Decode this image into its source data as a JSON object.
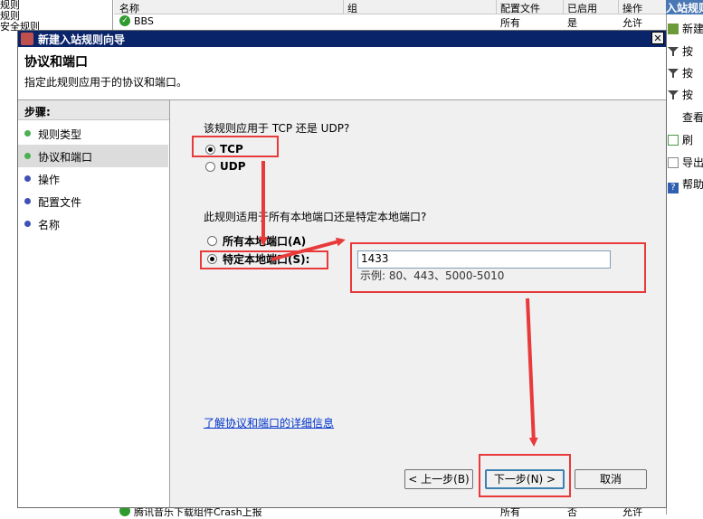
{
  "background": {
    "left_items": [
      "规则",
      "规则",
      "安全规则"
    ],
    "table_headers": [
      "名称",
      "组",
      "配置文件",
      "已启用",
      "操作"
    ],
    "row": {
      "name": "BBS",
      "profile": "所有",
      "enabled": "是",
      "action": "允许"
    },
    "bottom_row": {
      "name": "腾讯音乐下载组件Crash上报",
      "profile": "所有",
      "enabled": "否",
      "action": "允许"
    },
    "right_panel": {
      "title": "入站规则",
      "actions": [
        {
          "label": "新建",
          "icon": "new-rule-icon"
        },
        {
          "label": "按",
          "icon": "filter-icon"
        },
        {
          "label": "按",
          "icon": "filter-icon"
        },
        {
          "label": "按",
          "icon": "filter-icon"
        },
        {
          "label": "查看",
          "icon": "view-icon"
        },
        {
          "label": "刷",
          "icon": "refresh-icon"
        },
        {
          "label": "导出",
          "icon": "export-icon"
        },
        {
          "label": "帮助",
          "icon": "help-icon"
        }
      ]
    }
  },
  "dialog": {
    "title": "新建入站规则向导",
    "close": "✕",
    "header_title": "协议和端口",
    "header_subtitle": "指定此规则应用于的协议和端口。",
    "steps_title": "步骤:",
    "steps": [
      {
        "label": "规则类型",
        "color": "#4caf50"
      },
      {
        "label": "协议和端口",
        "color": "#4caf50"
      },
      {
        "label": "操作",
        "color": "#3f51b5"
      },
      {
        "label": "配置文件",
        "color": "#3f51b5"
      },
      {
        "label": "名称",
        "color": "#3f51b5"
      }
    ],
    "protocol_question": "该规则应用于 TCP 还是 UDP?",
    "tcp_label": "TCP",
    "udp_label": "UDP",
    "port_question": "此规则适用于所有本地端口还是特定本地端口?",
    "all_ports_label": "所有本地端口(A)",
    "specific_ports_label": "特定本地端口(S):",
    "port_value": "1433",
    "port_example": "示例: 80、443、5000-5010",
    "learn_more_link": "了解协议和端口的详细信息",
    "back_button": "< 上一步(B)",
    "next_button": "下一步(N) >",
    "cancel_button": "取消"
  },
  "annotation_color": "#e83a3a"
}
